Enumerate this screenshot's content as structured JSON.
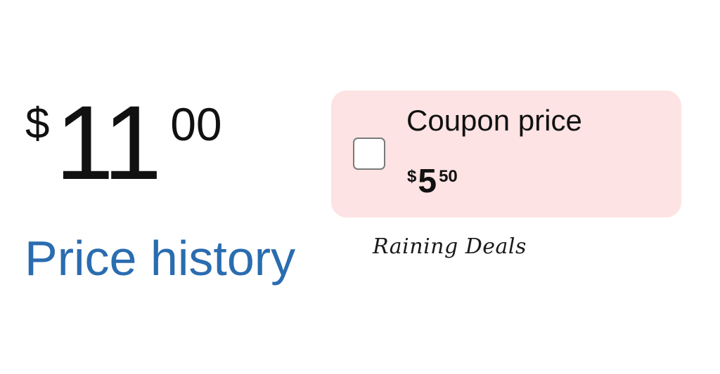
{
  "price": {
    "symbol": "$",
    "whole": "11",
    "fraction": "00"
  },
  "price_history": {
    "label": "Price history"
  },
  "coupon": {
    "label": "Coupon price",
    "checked": false,
    "price_symbol": "$",
    "price_whole": "5",
    "price_fraction": "50"
  },
  "watermark": "Raining Deals",
  "colors": {
    "link": "#2a6cb0",
    "coupon_background": "#fde3e3",
    "text": "#111111"
  }
}
